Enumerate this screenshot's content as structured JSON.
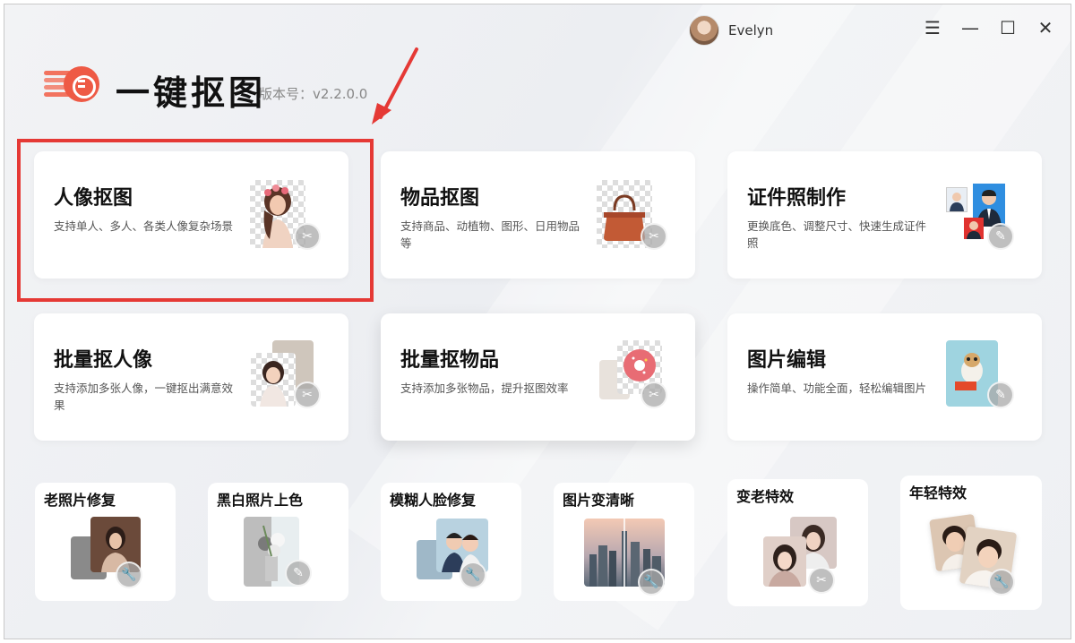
{
  "user": {
    "name": "Evelyn"
  },
  "app": {
    "title": "一键抠图",
    "version": "版本号：v2.2.0.0"
  },
  "window_controls": [
    {
      "icon": "menu-icon",
      "glyph": "☰"
    },
    {
      "icon": "minimize-icon",
      "glyph": "—"
    },
    {
      "icon": "maximize-icon",
      "glyph": "☐"
    },
    {
      "icon": "close-icon",
      "glyph": "✕"
    }
  ],
  "cards": [
    {
      "title": "人像抠图",
      "desc": "支持单人、多人、各类人像复杂场景",
      "icon": "scissors-icon"
    },
    {
      "title": "物品抠图",
      "desc": "支持商品、动植物、图形、日用物品等",
      "icon": "scissors-icon"
    },
    {
      "title": "证件照制作",
      "desc": "更换底色、调整尺寸、快速生成证件照",
      "icon": "pencil-icon"
    },
    {
      "title": "批量抠人像",
      "desc": "支持添加多张人像，一键抠出满意效果",
      "icon": "scissors-icon"
    },
    {
      "title": "批量抠物品",
      "desc": "支持添加多张物品，提升抠图效率",
      "icon": "scissors-icon"
    },
    {
      "title": "图片编辑",
      "desc": "操作简单、功能全面，轻松编辑图片",
      "icon": "pencil-icon"
    }
  ],
  "small_cards": [
    {
      "title": "老照片修复",
      "icon": "wrench-icon"
    },
    {
      "title": "黑白照片上色",
      "icon": "pencil-icon"
    },
    {
      "title": "模糊人脸修复",
      "icon": "wrench-icon"
    },
    {
      "title": "图片变清晰",
      "icon": "wrench-icon"
    },
    {
      "title": "变老特效",
      "icon": "scissors-icon"
    },
    {
      "title": "年轻特效",
      "icon": "wrench-icon"
    }
  ],
  "colors": {
    "brand": "#ee5a45",
    "highlight": "#e53935"
  }
}
